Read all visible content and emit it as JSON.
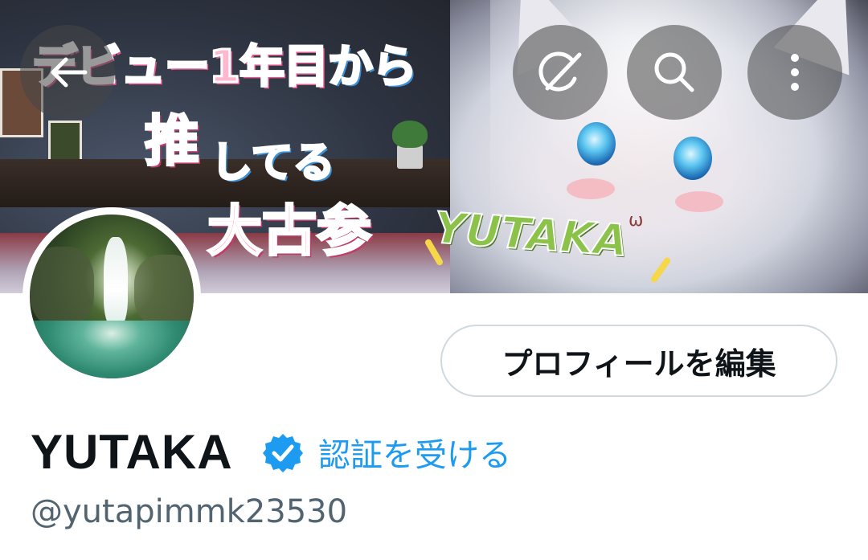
{
  "banner": {
    "line1_pink": "デビュー1年目",
    "line1_blue": "から",
    "line2a": "推",
    "line2b": "してる",
    "line3": "大古参",
    "name_art": "YUTAKA"
  },
  "profile": {
    "display_name": "YUTAKA",
    "get_verified": "認証を受ける",
    "handle": "@yutapimmk23530",
    "edit_button": "プロフィールを編集"
  },
  "icons": {
    "back": "back-arrow-icon",
    "grok": "grok-icon",
    "search": "search-icon",
    "more": "more-vertical-icon",
    "verified": "verified-badge-icon"
  },
  "colors": {
    "accent": "#1d9bf0",
    "text": "#0f1419",
    "secondary_text": "#536471",
    "border": "#cfd9de"
  }
}
